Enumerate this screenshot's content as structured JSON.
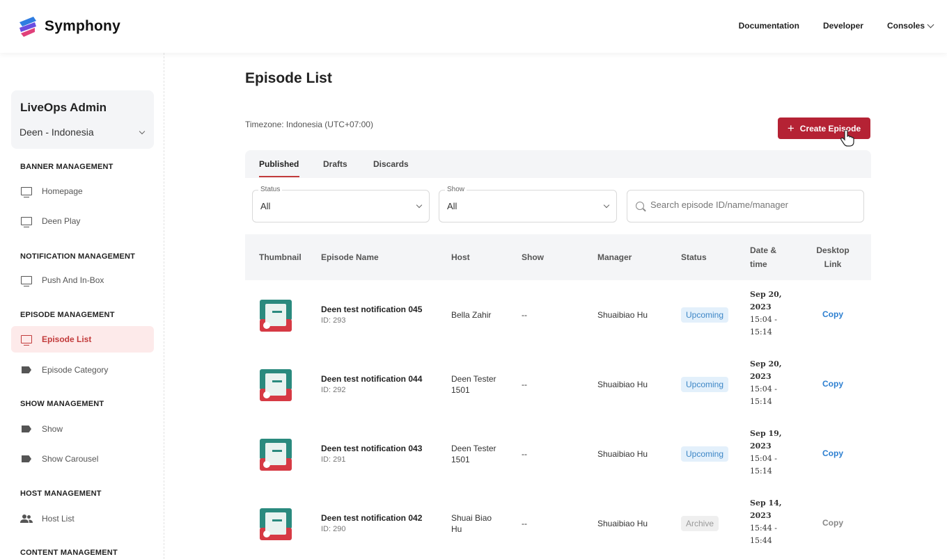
{
  "brand": {
    "name": "Symphony"
  },
  "topnav": {
    "documentation": "Documentation",
    "developer": "Developer",
    "consoles": "Consoles"
  },
  "sidebar": {
    "org_title": "LiveOps Admin",
    "org_select": "Deen - Indonesia",
    "sections": [
      {
        "title": "BANNER MANAGEMENT",
        "items": [
          {
            "label": "Homepage",
            "icon": "monitor-icon"
          },
          {
            "label": "Deen Play",
            "icon": "monitor-icon"
          }
        ]
      },
      {
        "title": "NOTIFICATION MANAGEMENT",
        "items": [
          {
            "label": "Push And In-Box",
            "icon": "monitor-icon"
          }
        ]
      },
      {
        "title": "EPISODE MANAGEMENT",
        "items": [
          {
            "label": "Episode List",
            "icon": "monitor-icon",
            "active": true
          },
          {
            "label": "Episode Category",
            "icon": "tag-icon"
          }
        ]
      },
      {
        "title": "SHOW MANAGEMENT",
        "items": [
          {
            "label": "Show",
            "icon": "tag-icon"
          },
          {
            "label": "Show Carousel",
            "icon": "tag-icon"
          }
        ]
      },
      {
        "title": "HOST MANAGEMENT",
        "items": [
          {
            "label": "Host List",
            "icon": "users-icon"
          }
        ]
      },
      {
        "title": "CONTENT MANAGEMENT",
        "items": []
      }
    ]
  },
  "main": {
    "title": "Episode List",
    "timezone": "Timezone: Indonesia (UTC+07:00)",
    "create_button": "Create Episode",
    "tabs": [
      "Published",
      "Drafts",
      "Discards"
    ],
    "active_tab": "Published",
    "filters": {
      "status_label": "Status",
      "status_value": "All",
      "show_label": "Show",
      "show_value": "All",
      "search_placeholder": "Search episode ID/name/manager"
    },
    "columns": [
      "Thumbnail",
      "Episode Name",
      "Host",
      "Show",
      "Manager",
      "Status",
      "Date &\ntime",
      "Desktop\nLink"
    ],
    "rows": [
      {
        "name": "Deen test notification 045",
        "id": "ID: 293",
        "host": "Bella Zahir",
        "show": "--",
        "manager": "Shuaibiao Hu",
        "status": "Upcoming",
        "date": "Sep 20,",
        "year": "2023",
        "time1": "15:04 -",
        "time2": "15:14",
        "link": "Copy"
      },
      {
        "name": "Deen test notification 044",
        "id": "ID: 292",
        "host": "Deen Tester\n1501",
        "show": "--",
        "manager": "Shuaibiao Hu",
        "status": "Upcoming",
        "date": "Sep 20,",
        "year": "2023",
        "time1": "15:04 -",
        "time2": "15:14",
        "link": "Copy"
      },
      {
        "name": "Deen test notification 043",
        "id": "ID: 291",
        "host": "Deen Tester\n1501",
        "show": "--",
        "manager": "Shuaibiao Hu",
        "status": "Upcoming",
        "date": "Sep 19,",
        "year": "2023",
        "time1": "15:04 -",
        "time2": "15:14",
        "link": "Copy"
      },
      {
        "name": "Deen test notification 042",
        "id": "ID: 290",
        "host": "Shuai Biao\nHu",
        "show": "--",
        "manager": "Shuaibiao Hu",
        "status": "Archive",
        "date": "Sep 14,",
        "year": "2023",
        "time1": "15:44 -",
        "time2": "15:44",
        "link": "Copy"
      }
    ]
  },
  "colors": {
    "accent": "#b52234",
    "active_bg": "#fdeaea",
    "link": "#2d7fd0",
    "upcoming_bg": "#e3f0fb"
  }
}
